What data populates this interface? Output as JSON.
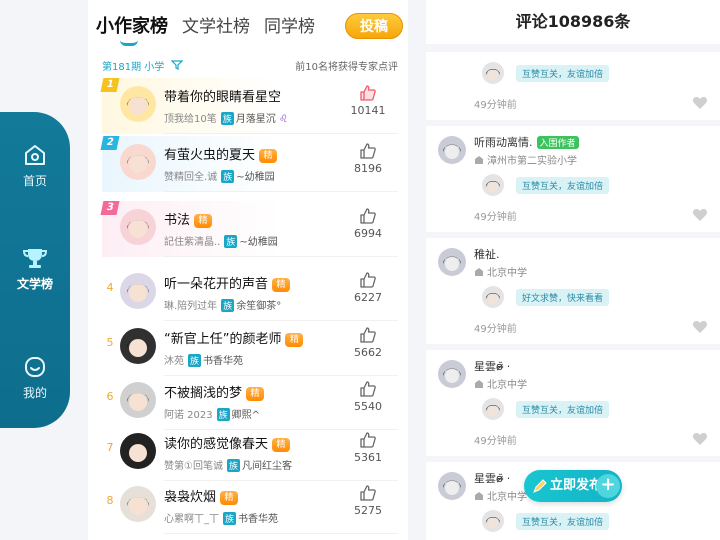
{
  "nav": {
    "home_label": "首页",
    "lit_label": "文学榜",
    "me_label": "我的"
  },
  "board": {
    "tabs": [
      "小作家榜",
      "文学社榜",
      "同学榜"
    ],
    "post_label": "投稿",
    "period": "第181期 小学",
    "notice": "前10名将获得专家点评",
    "badge_label": "精",
    "clan_label": "族",
    "entries": [
      {
        "rank": "1",
        "title": "带着你的眼睛看星空",
        "author": "顶我给10笔",
        "clan": "月落星沉",
        "extra": "♌",
        "likes": "10141",
        "liked": true
      },
      {
        "rank": "2",
        "title": "有萤火虫的夏天",
        "author": "赞精回全.诚",
        "clan": "~幼稚园",
        "extra": "",
        "likes": "8196",
        "liked": false
      },
      {
        "rank": "3",
        "title": "书法",
        "author": "記住紫清晶..",
        "clan": "~幼稚园",
        "extra": "",
        "likes": "6994",
        "liked": false
      },
      {
        "rank": "4",
        "title": "听一朵花开的声音",
        "author": "琳.陪列过年",
        "clan": "余笙御茶°",
        "extra": "",
        "likes": "6227",
        "liked": false
      },
      {
        "rank": "5",
        "title": "“新官上任”的颜老师",
        "author": "沐苑",
        "clan": "书香华苑",
        "extra": "",
        "likes": "5662",
        "liked": false
      },
      {
        "rank": "6",
        "title": "不被搁浅的梦",
        "author": "阿诺 2023",
        "clan": "卿熙^",
        "extra": "",
        "likes": "5540",
        "liked": false
      },
      {
        "rank": "7",
        "title": "读你的感觉像春天",
        "author": "赞第①回笔诚",
        "clan": "凡间红尘客",
        "extra": "",
        "likes": "5361",
        "liked": false
      },
      {
        "rank": "8",
        "title": "袅袅炊烟",
        "author": "心累啊丅_丅",
        "clan": "书香华苑",
        "extra": "",
        "likes": "5275",
        "liked": false
      }
    ]
  },
  "comments": {
    "header": "评论108986条",
    "items": [
      {
        "name": "",
        "tag": "",
        "school": "",
        "reply": "互赞互关，友谊加倍",
        "time": "49分钟前"
      },
      {
        "name": "听雨动离情.",
        "tag": "入围作者",
        "school": "漳州市第二实验小学",
        "reply": "互赞互关，友谊加倍",
        "time": "49分钟前"
      },
      {
        "name": "稚祉.",
        "tag": "",
        "school": "北京中学",
        "reply": "好文求赞，快来看看",
        "time": "49分钟前"
      },
      {
        "name": "星雲ʚ̴̶̷̆ ·",
        "tag": "",
        "school": "北京中学",
        "reply": "互赞互关，友谊加倍",
        "time": "49分钟前"
      },
      {
        "name": "星雲ʚ̴̶̷̆ ·",
        "tag": "",
        "school": "北京中学",
        "reply": "互赞互关，友谊加倍",
        "time": ""
      }
    ],
    "publish_label": "立即发布"
  },
  "colors": {
    "accent": "#1aa6c7",
    "nav_bg": "#137a9a",
    "gold": "#f6a609"
  }
}
